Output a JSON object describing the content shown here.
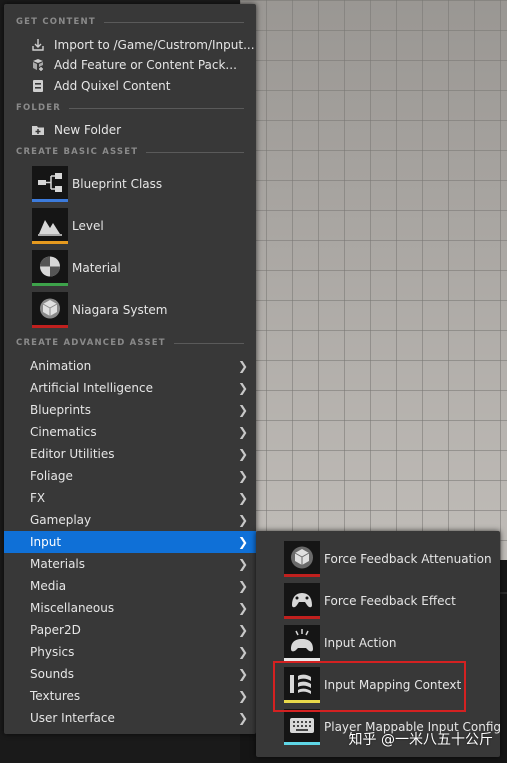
{
  "sections": {
    "get_content": "GET CONTENT",
    "folder": "FOLDER",
    "create_basic": "CREATE BASIC ASSET",
    "create_advanced": "CREATE ADVANCED ASSET"
  },
  "get_content_items": [
    {
      "label": "Import to /Game/Custrom/Input...",
      "icon": "import-icon"
    },
    {
      "label": "Add Feature or Content Pack...",
      "icon": "content-pack-icon"
    },
    {
      "label": "Add Quixel Content",
      "icon": "quixel-icon"
    }
  ],
  "folder_items": [
    {
      "label": "New Folder",
      "icon": "new-folder-icon"
    }
  ],
  "basic_assets": [
    {
      "label": "Blueprint Class",
      "icon": "blueprint-class-icon",
      "color": "#3c7bdc"
    },
    {
      "label": "Level",
      "icon": "level-icon",
      "color": "#e69a1f"
    },
    {
      "label": "Material",
      "icon": "material-icon",
      "color": "#3da34a"
    },
    {
      "label": "Niagara System",
      "icon": "niagara-system-icon",
      "color": "#c0201e"
    }
  ],
  "advanced_categories": [
    "Animation",
    "Artificial Intelligence",
    "Blueprints",
    "Cinematics",
    "Editor Utilities",
    "Foliage",
    "FX",
    "Gameplay",
    "Input",
    "Materials",
    "Media",
    "Miscellaneous",
    "Paper2D",
    "Physics",
    "Sounds",
    "Textures",
    "User Interface"
  ],
  "selected_category": "Input",
  "input_submenu": [
    {
      "label": "Force Feedback Attenuation",
      "icon": "force-feedback-attenuation-icon",
      "color": "#c0201e"
    },
    {
      "label": "Force Feedback Effect",
      "icon": "force-feedback-effect-icon",
      "color": "#c0201e"
    },
    {
      "label": "Input Action",
      "icon": "input-action-icon",
      "color": "#e8e8e8"
    },
    {
      "label": "Input Mapping Context",
      "icon": "input-mapping-context-icon",
      "color": "#e8d84a"
    },
    {
      "label": "Player Mappable Input Config",
      "icon": "player-mappable-input-config-icon",
      "color": "#5fd6e6"
    }
  ],
  "watermark": "知乎 @一米八五十公斤"
}
